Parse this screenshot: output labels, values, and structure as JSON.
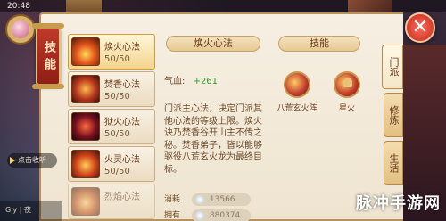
{
  "status_bar": {
    "time": "20:48"
  },
  "panel_tab": {
    "label": "技能"
  },
  "skills": [
    {
      "name": "焕火心法",
      "level": "50/50",
      "selected": true
    },
    {
      "name": "焚香心法",
      "level": "50/50",
      "selected": false
    },
    {
      "name": "狱火心法",
      "level": "50/50",
      "selected": false
    },
    {
      "name": "火灵心法",
      "level": "50/50",
      "selected": false
    },
    {
      "name": "烈焰心法",
      "level": "50/50",
      "selected": false
    }
  ],
  "detail": {
    "title": "焕火心法",
    "stat_label": "气血:",
    "stat_value": "+261",
    "description": "门派主心法，决定门派其他心法的等级上限。焕火诀乃焚香谷开山主不传之秘。焚香弟子，皆以能够驱役八荒玄火龙为最终目标。",
    "cost_label_1": "消耗",
    "cost_value_1": "13566",
    "cost_label_2": "拥有",
    "cost_value_2": "880374"
  },
  "techniques": {
    "title": "技能",
    "items": [
      {
        "label": "八荒玄火阵",
        "icon": "flame-swirl-icon"
      },
      {
        "label": "星火",
        "icon": "lock-icon"
      }
    ]
  },
  "side_tabs": [
    "门派",
    "修炼",
    "生活"
  ],
  "hud": {
    "chat_button": "点击收听",
    "bottom_text": "Giy | 夜"
  },
  "watermark": "脉冲手游网"
}
